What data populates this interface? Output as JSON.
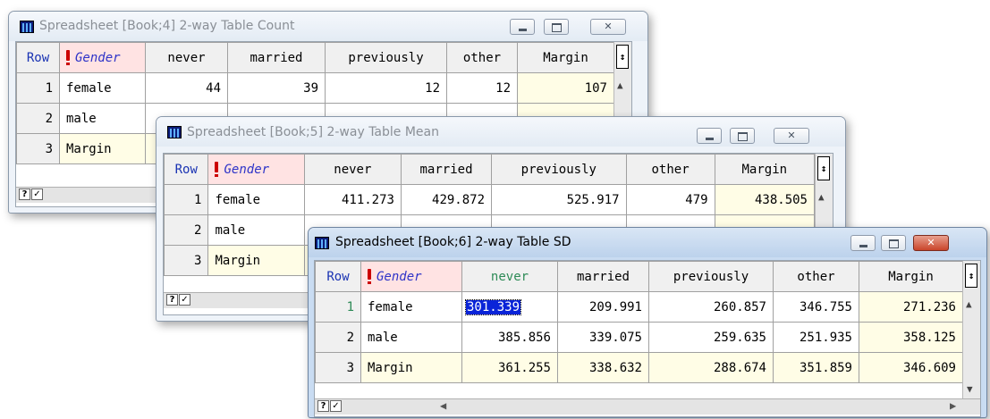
{
  "windows": {
    "count": {
      "title": "Spreadsheet [Book;4] 2-way Table Count",
      "headers": [
        "Row",
        "Gender",
        "never",
        "married",
        "previously",
        "other",
        "Margin"
      ],
      "rows": [
        {
          "row": "1",
          "label": "female",
          "values": [
            "44",
            "39",
            "12",
            "12",
            "107"
          ]
        },
        {
          "row": "2",
          "label": "male",
          "values": []
        },
        {
          "row": "3",
          "label": "Margin",
          "values": []
        }
      ]
    },
    "mean": {
      "title": "Spreadsheet [Book;5] 2-way Table Mean",
      "headers": [
        "Row",
        "Gender",
        "never",
        "married",
        "previously",
        "other",
        "Margin"
      ],
      "rows": [
        {
          "row": "1",
          "label": "female",
          "values": [
            "411.273",
            "429.872",
            "525.917",
            "479",
            "438.505"
          ]
        },
        {
          "row": "2",
          "label": "male",
          "values": []
        },
        {
          "row": "3",
          "label": "Margin",
          "values": []
        }
      ]
    },
    "sd": {
      "title": "Spreadsheet [Book;6] 2-way Table SD",
      "headers": [
        "Row",
        "Gender",
        "never",
        "married",
        "previously",
        "other",
        "Margin"
      ],
      "rows": [
        {
          "row": "1",
          "label": "female",
          "values": [
            "301.339",
            "209.991",
            "260.857",
            "346.755",
            "271.236"
          ]
        },
        {
          "row": "2",
          "label": "male",
          "values": [
            "385.856",
            "339.075",
            "259.635",
            "251.935",
            "358.125"
          ]
        },
        {
          "row": "3",
          "label": "Margin",
          "values": [
            "361.255",
            "338.632",
            "288.674",
            "351.859",
            "346.609"
          ]
        }
      ]
    }
  },
  "statusbar": {
    "help_label": "?",
    "check_label": "✓"
  },
  "icons": {
    "pin": "pin-icon",
    "scroll_up": "scroll-up-icon",
    "scroll_down": "scroll-down-icon",
    "scroll_left": "scroll-left-icon",
    "scroll_right": "scroll-right-icon"
  },
  "colors": {
    "group_header_bg": "#ffe3e3",
    "margin_bg": "#fffde6",
    "selection": "#0a24d8",
    "selected_column_header_text": "#2e8b57"
  }
}
